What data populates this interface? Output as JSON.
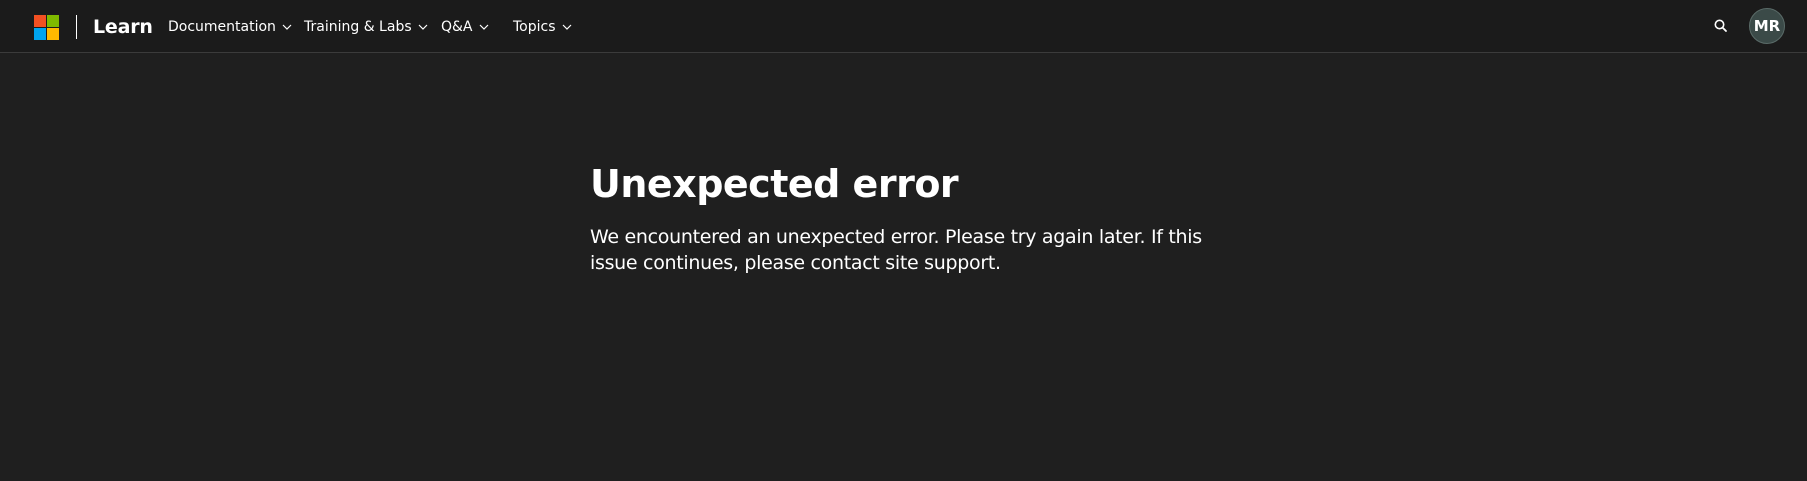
{
  "header": {
    "brand": "Learn",
    "nav": [
      {
        "label": "Documentation"
      },
      {
        "label": "Training & Labs"
      },
      {
        "label": "Q&A"
      },
      {
        "label": "Topics"
      }
    ],
    "search_icon": "search-icon",
    "avatar_initials": "MR"
  },
  "main": {
    "title": "Unexpected error",
    "message": "We encountered an unexpected error. Please try again later. If this issue continues, please contact site support."
  },
  "colors": {
    "background": "#1f1f1f",
    "header_background": "#1b1b1b",
    "text": "#ffffff",
    "logo_red": "#f25022",
    "logo_green": "#7fba00",
    "logo_blue": "#00a4ef",
    "logo_yellow": "#ffb900",
    "avatar_background": "#3b4a48"
  }
}
